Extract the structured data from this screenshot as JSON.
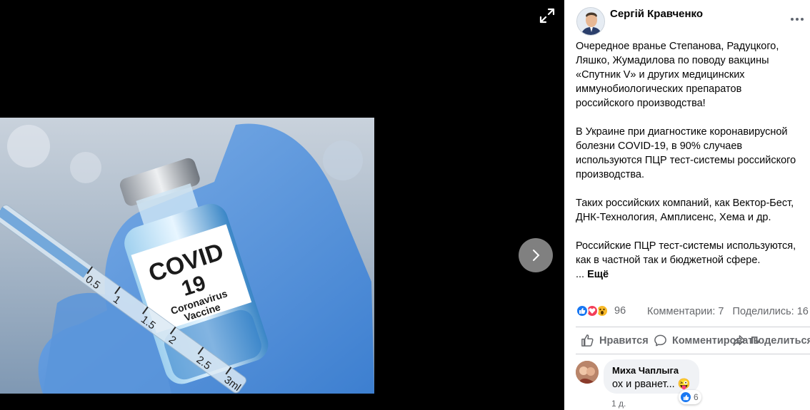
{
  "post": {
    "author": "Сергій Кравченко",
    "paragraphs": [
      "Очередное вранье Степанова, Радуцкого,\nЛяшко, Жумадилова по поводу вакцины\n«Спутник V» и других медицинских\nиммунобиологических препаратов\nроссийского производства!",
      "В Украине при диагностике коронавирусной\nболезни COVID-19, в 90% случаев\nиспользуются ПЦР тест-системы российского\nпроизводства.",
      "Таких российских компаний, как Вектор-Бест,\nДНК-Технология, Амплисенс, Хема и др.",
      "Российские ПЦР тест-системы используются,\nкак в частной так и бюджетной сфере."
    ],
    "ellipsis": "... ",
    "see_more": "Ещё",
    "reactions_count": "96",
    "comments_count": "Комментарии: 7",
    "shares_count": "Поделились: 16"
  },
  "photo": {
    "label_line1": "COVID",
    "label_line2": "19",
    "label_line3": "Coronavirus",
    "label_line4": "Vaccine",
    "syringe_marks": [
      "0.5",
      "1",
      "1.5",
      "2",
      "2.5",
      "3ml"
    ]
  },
  "actions": {
    "like": "Нравится",
    "comment": "Комментировать",
    "share": "Поделиться"
  },
  "comment": {
    "name": "Миха Чаплыга",
    "text": "ох и рванет... ",
    "emoji": "😜",
    "reactions": "6",
    "time": "1 д."
  },
  "icons": {
    "expand": "expand-icon",
    "next": "chevron-right-icon",
    "more": "more-dots-icon",
    "like": "like-icon",
    "love": "love-icon",
    "wow": "wow-icon",
    "comment": "comment-icon",
    "share": "share-icon"
  },
  "colors": {
    "accent": "#1877f2",
    "love": "#f33e58",
    "wow": "#f7b928",
    "secondary_text": "#65676b"
  }
}
